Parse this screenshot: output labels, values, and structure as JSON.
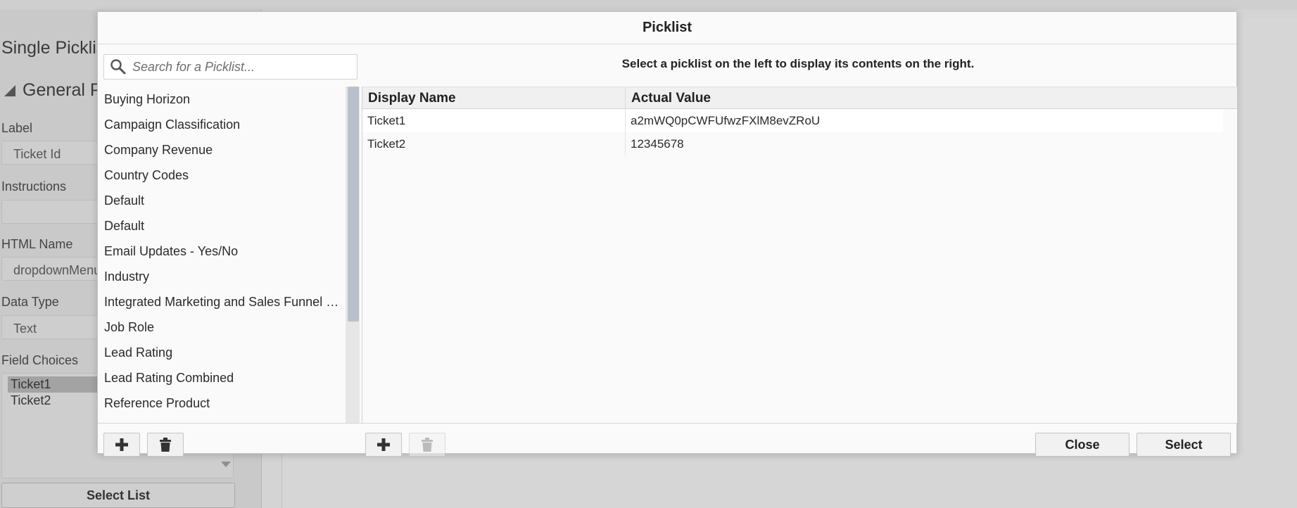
{
  "background": {
    "title": "Single Picklis",
    "section": "General P",
    "fields": [
      {
        "label": "Label",
        "value": "Ticket Id"
      },
      {
        "label": "Instructions",
        "value": ""
      },
      {
        "label": "HTML Name",
        "value": "dropdownMenu"
      },
      {
        "label": "Data Type",
        "value": "Text"
      }
    ],
    "field_choices_label": "Field Choices",
    "field_choices": [
      "Ticket1",
      "Ticket2"
    ],
    "select_list_button": "Select List"
  },
  "modal": {
    "title": "Picklist",
    "search": {
      "placeholder": "Search for a Picklist...",
      "value": ""
    },
    "instruction": "Select a picklist on the left to display its contents on the right.",
    "picklists": [
      "Buying Horizon",
      "Campaign Classification",
      "Company Revenue",
      "Country Codes",
      "Default",
      "Default",
      "Email Updates - Yes/No",
      "Industry",
      "Integrated Marketing and Sales Funnel Stages",
      "Job Role",
      "Lead Rating",
      "Lead Rating Combined",
      "Reference Product"
    ],
    "table": {
      "columns": [
        "Display Name",
        "Actual Value"
      ],
      "rows": [
        {
          "display_name": "Ticket1",
          "actual_value": "a2mWQ0pCWFUfwzFXlM8evZRoU"
        },
        {
          "display_name": "Ticket2",
          "actual_value": "12345678"
        }
      ]
    },
    "footer": {
      "add_icon": "plus-icon",
      "delete_icon": "trash-icon",
      "close_label": "Close",
      "select_label": "Select"
    }
  }
}
